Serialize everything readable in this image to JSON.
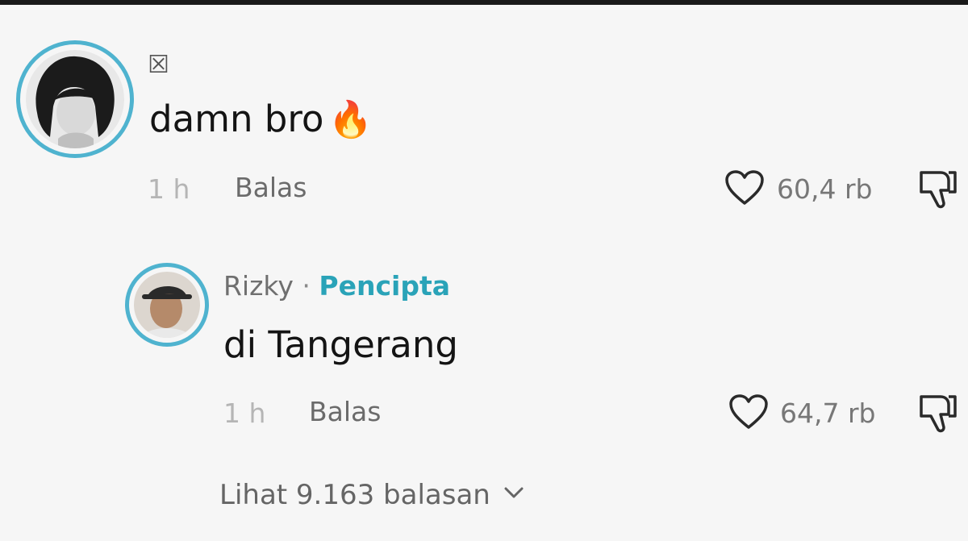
{
  "comments": [
    {
      "username_glyph": "☒",
      "text": "damn bro",
      "emoji": "🔥",
      "time": "1 h",
      "reply_label": "Balas",
      "likes": "60,4 rb",
      "avatar_icon": "user-avatar-dark",
      "liked": false
    }
  ],
  "reply": {
    "username": "Rizky",
    "separator": "·",
    "creator_badge": "Pencipta",
    "text": "di Tangerang",
    "time": "1 h",
    "reply_label": "Balas",
    "likes": "64,7 rb",
    "avatar_icon": "user-avatar-photo",
    "liked": false
  },
  "view_replies": {
    "label": "Lihat 9.163 balasan",
    "icon": "chevron-down-icon"
  },
  "colors": {
    "ring": "#4fb3cf",
    "creator": "#2aa3b8",
    "background": "#f6f6f6"
  }
}
